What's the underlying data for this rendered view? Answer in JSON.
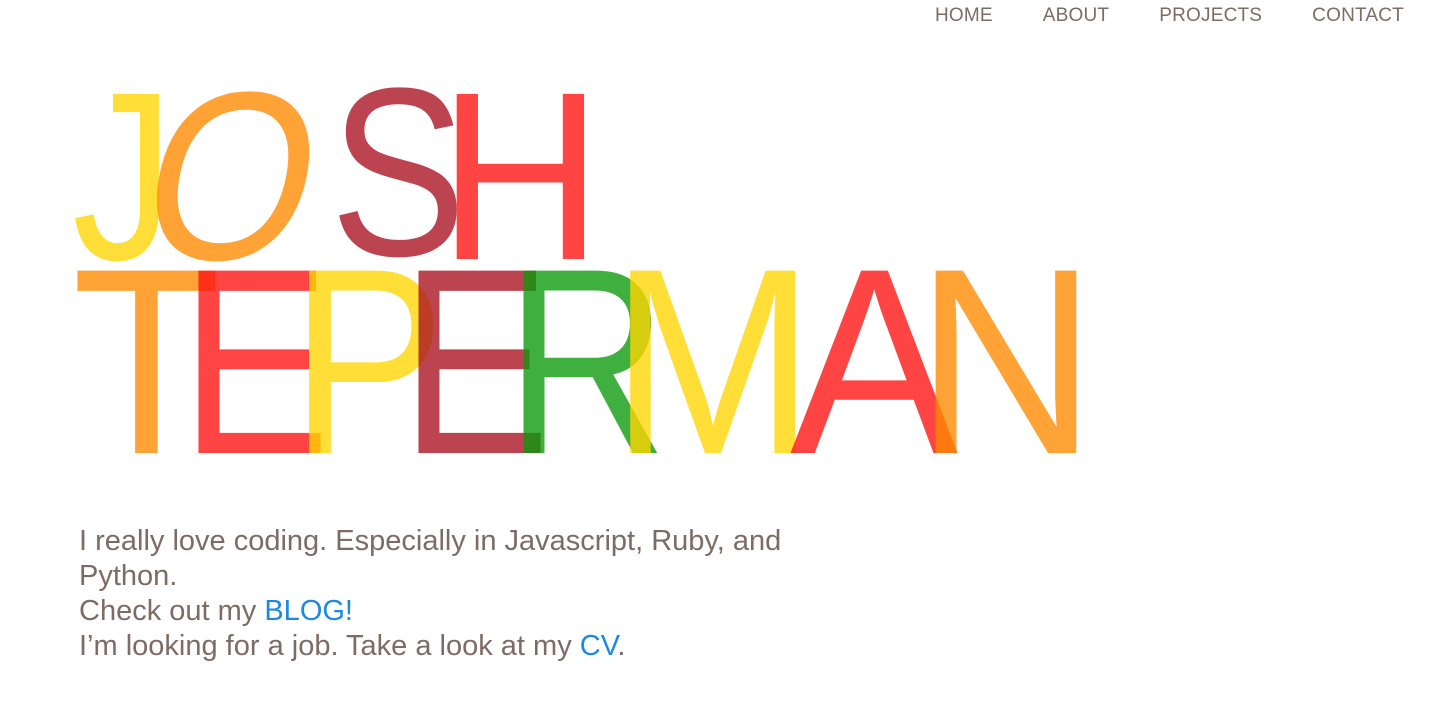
{
  "nav": {
    "home": "HOME",
    "about": "ABOUT",
    "projects": "PROJECTS",
    "contact": "CONTACT"
  },
  "logo": {
    "first_name": [
      {
        "char": "J",
        "color": "#ffd600"
      },
      {
        "char": "O",
        "color": "#ff8a00"
      },
      {
        "char": "S",
        "color": "#a9101f"
      },
      {
        "char": "H",
        "color": "#ff1010"
      }
    ],
    "last_name": [
      {
        "char": "T",
        "color": "#ff8a00"
      },
      {
        "char": "E",
        "color": "#ff1010"
      },
      {
        "char": "P",
        "color": "#ffd600"
      },
      {
        "char": "E",
        "color": "#a9101f"
      },
      {
        "char": "R",
        "color": "#0a9a0a"
      },
      {
        "char": "M",
        "color": "#ffd600"
      },
      {
        "char": "A",
        "color": "#ff1010"
      },
      {
        "char": "N",
        "color": "#ff8a00"
      }
    ]
  },
  "intro": {
    "line1": "I really love coding. Especially in Javascript, Ruby, and Python.",
    "line2_prefix": "Check out my ",
    "blog_link": "BLOG!",
    "line3_prefix": "I’m looking for a job. Take a look at my ",
    "cv_link": "CV",
    "line3_suffix": "."
  },
  "colors": {
    "text": "#7d6b66",
    "link": "#1e88e5",
    "yellow": "#ffd600",
    "orange": "#ff8a00",
    "red": "#ff1010",
    "dark_red": "#a9101f",
    "green": "#0a9a0a"
  }
}
